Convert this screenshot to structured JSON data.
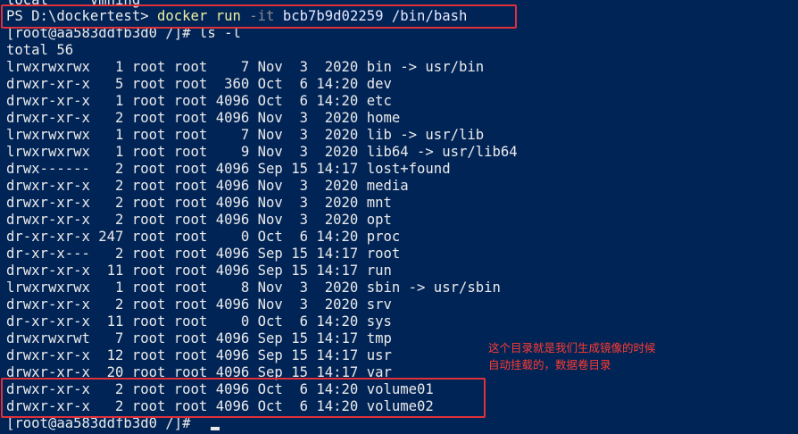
{
  "terminal": {
    "top_partial": "local     vmhing",
    "ps_prompt": "PS D:\\dockertest>",
    "command": {
      "main": "docker run",
      "flag": "-it",
      "args": "bcb7b9d02259 /bin/bash"
    },
    "ls_line": "[root@aa583ddfb3d0 /]# ls -l",
    "total_line": "total 56",
    "listing": [
      "lrwxrwxrwx   1 root root    7 Nov  3  2020 bin -> usr/bin",
      "drwxr-xr-x   5 root root  360 Oct  6 14:20 dev",
      "drwxr-xr-x   1 root root 4096 Oct  6 14:20 etc",
      "drwxr-xr-x   2 root root 4096 Nov  3  2020 home",
      "lrwxrwxrwx   1 root root    7 Nov  3  2020 lib -> usr/lib",
      "lrwxrwxrwx   1 root root    9 Nov  3  2020 lib64 -> usr/lib64",
      "drwx------   2 root root 4096 Sep 15 14:17 lost+found",
      "drwxr-xr-x   2 root root 4096 Nov  3  2020 media",
      "drwxr-xr-x   2 root root 4096 Nov  3  2020 mnt",
      "drwxr-xr-x   2 root root 4096 Nov  3  2020 opt",
      "dr-xr-xr-x 247 root root    0 Oct  6 14:20 proc",
      "dr-xr-x---   2 root root 4096 Sep 15 14:17 root",
      "drwxr-xr-x  11 root root 4096 Sep 15 14:17 run",
      "lrwxrwxrwx   1 root root    8 Nov  3  2020 sbin -> usr/sbin",
      "drwxr-xr-x   2 root root 4096 Nov  3  2020 srv",
      "dr-xr-xr-x  11 root root    0 Oct  6 14:20 sys",
      "drwxrwxrwt   7 root root 4096 Sep 15 14:17 tmp",
      "drwxr-xr-x  12 root root 4096 Sep 15 14:17 usr",
      "drwxr-xr-x  20 root root 4096 Sep 15 14:17 var",
      "drwxr-xr-x   2 root root 4096 Oct  6 14:20 volume01",
      "drwxr-xr-x   2 root root 4096 Oct  6 14:20 volume02"
    ],
    "final_prompt": "[root@aa583ddfb3d0 /]#"
  },
  "annotation": {
    "line1": "这个目录就是我们生成镜像的时候",
    "line2": "自动挂载的，数据卷目录"
  },
  "colors": {
    "background": "#012456",
    "text": "#ebebeb",
    "command": "#f0f0a0",
    "flag": "#8a8a8a",
    "highlight_box": "#e0303a",
    "annotation": "#ff3b30"
  }
}
